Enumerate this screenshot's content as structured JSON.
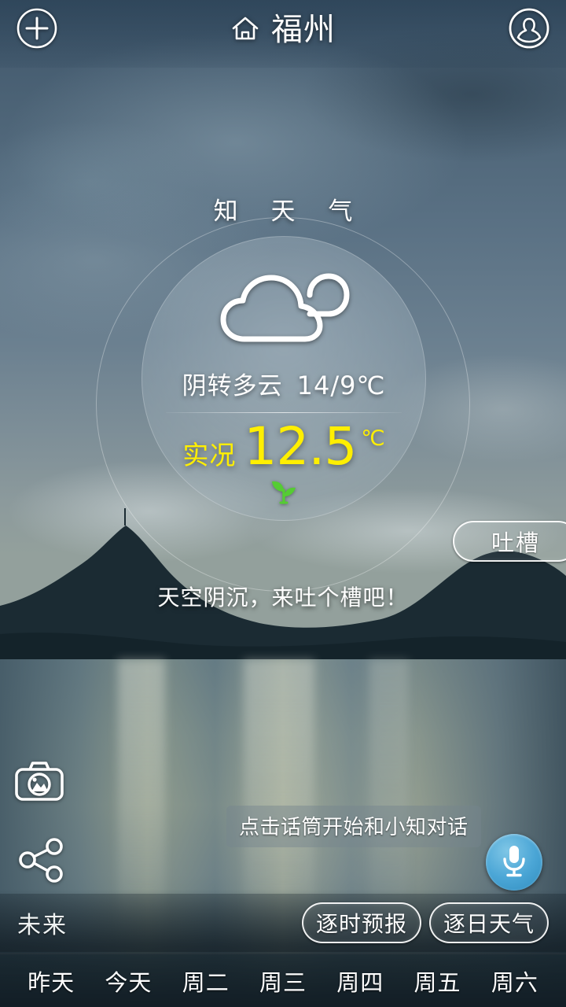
{
  "header": {
    "add_icon": "plus-circle-icon",
    "home_icon": "home-icon",
    "city": "福州",
    "profile_icon": "person-circle-icon"
  },
  "widget": {
    "brand_title": "知 天 气",
    "weather_icon": "cloudy-icon",
    "condition": "阴转多云",
    "temp_range": "14/9℃",
    "live_label": "实况",
    "live_value": "12.5",
    "live_unit": "℃",
    "sprout_icon": "sprout-icon"
  },
  "tucao": {
    "button_label": "吐槽",
    "prompt": "天空阴沉，来吐个槽吧！"
  },
  "tools": {
    "camera_icon": "camera-icon",
    "share_icon": "share-icon"
  },
  "voice": {
    "tip": "点击话筒开始和小知对话",
    "mic_icon": "microphone-icon"
  },
  "forecast_bar": {
    "future_label": "未来",
    "hourly_label": "逐时预报",
    "daily_label": "逐日天气"
  },
  "days": [
    {
      "label": "昨天"
    },
    {
      "label": "今天"
    },
    {
      "label": "周二"
    },
    {
      "label": "周三"
    },
    {
      "label": "周四"
    },
    {
      "label": "周五"
    },
    {
      "label": "周六"
    }
  ],
  "colors": {
    "accent_yellow": "#ffef00",
    "mic_blue": "#4ba6d6",
    "sprout_green": "#55cc33",
    "text_white": "#ffffff"
  }
}
